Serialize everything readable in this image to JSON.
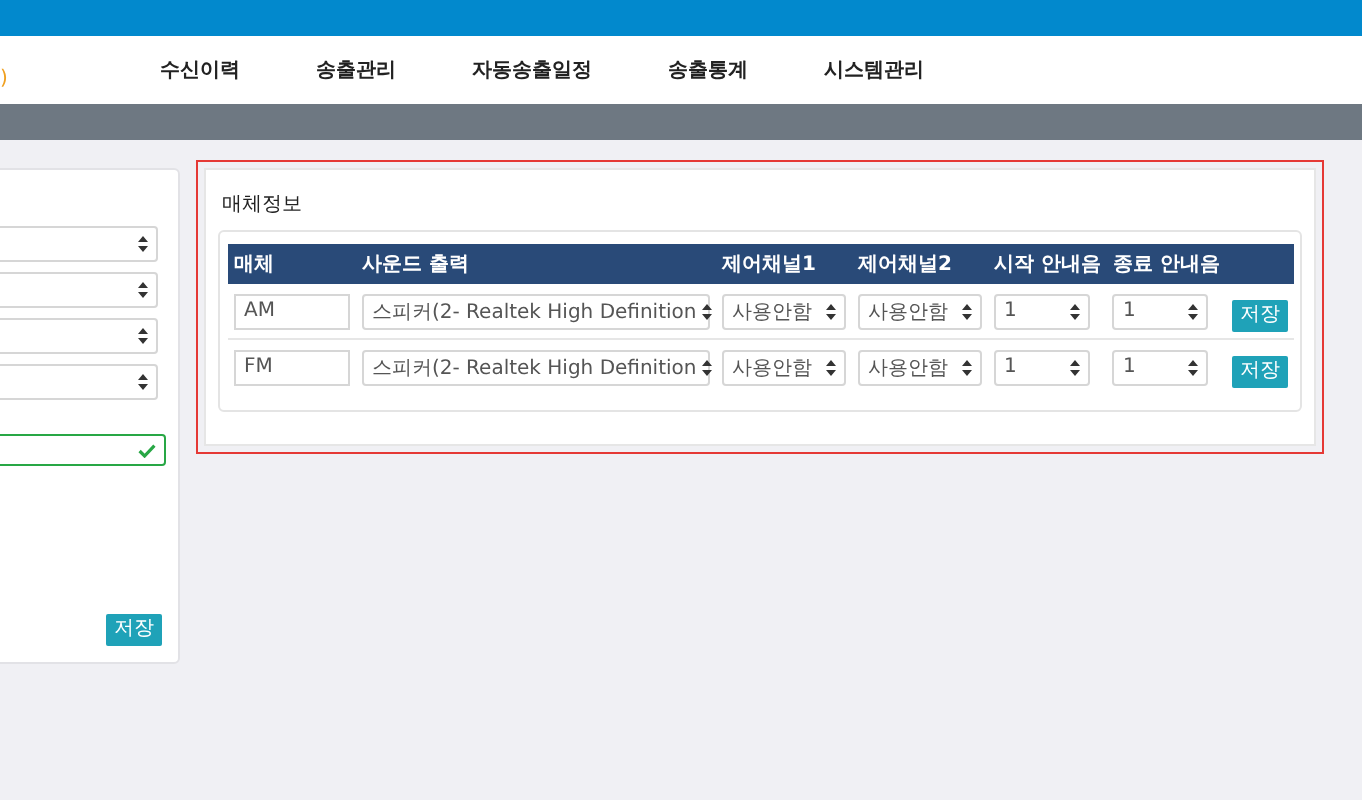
{
  "header": {
    "logo_fragment": ")"
  },
  "nav": [
    {
      "label": "수신이력"
    },
    {
      "label": "송출관리"
    },
    {
      "label": "자동송출일정"
    },
    {
      "label": "송출통계"
    },
    {
      "label": "시스템관리"
    }
  ],
  "left_panel": {
    "fields": [
      {
        "kind": "select"
      },
      {
        "kind": "select"
      },
      {
        "kind": "select"
      },
      {
        "kind": "select"
      },
      {
        "kind": "input",
        "valid": true
      }
    ],
    "save_button": "저장"
  },
  "media_panel": {
    "title": "매체정보",
    "columns": [
      "매체",
      "사운드 출력",
      "제어채널1",
      "제어채널2",
      "시작 안내음",
      "종료 안내음"
    ],
    "rows": [
      {
        "medium": "AM",
        "sound_output": "스피커(2- Realtek High Definition",
        "control_channel_1": "사용안함",
        "control_channel_2": "사용안함",
        "start_tone": "1",
        "end_tone": "1",
        "button": "저장"
      },
      {
        "medium": "FM",
        "sound_output": "스피커(2- Realtek High Definition",
        "control_channel_1": "사용안함",
        "control_channel_2": "사용안함",
        "start_tone": "1",
        "end_tone": "1",
        "button": "저장"
      }
    ]
  }
}
